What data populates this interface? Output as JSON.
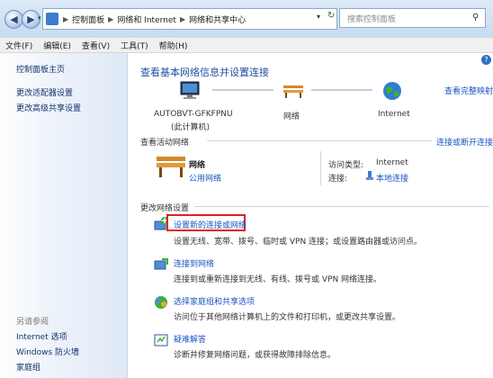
{
  "address": {
    "crumbs": [
      "控制面板",
      "网络和 Internet",
      "网络和共享中心"
    ],
    "search_placeholder": "搜索控制面板"
  },
  "menu": [
    "文件(F)",
    "编辑(E)",
    "查看(V)",
    "工具(T)",
    "帮助(H)"
  ],
  "sidebar": {
    "home": "控制面板主页",
    "links": [
      "更改适配器设置",
      "更改高级共享设置"
    ],
    "see_also": "另请参阅",
    "see_also_links": [
      "Internet 选项",
      "Windows 防火墙",
      "家庭组"
    ]
  },
  "main": {
    "title": "查看基本网络信息并设置连接",
    "view_full_map": "查看完整映射",
    "map": {
      "computer_name": "AUTOBVT-GFKFPNU",
      "computer_sub": "(此计算机)",
      "network": "网络",
      "internet": "Internet"
    },
    "active_label": "查看活动网络",
    "connect_disconnect": "连接或断开连接",
    "active": {
      "name": "网络",
      "type": "公用网络",
      "access_label": "访问类型:",
      "access_value": "Internet",
      "conn_label": "连接:",
      "conn_value": "本地连接"
    },
    "change_label": "更改网络设置",
    "tasks": [
      {
        "title": "设置新的连接或网络",
        "desc": "设置无线、宽带、拨号、临时或 VPN 连接；或设置路由器或访问点。"
      },
      {
        "title": "连接到网络",
        "desc": "连接到或重新连接到无线、有线、拨号或 VPN 网络连接。"
      },
      {
        "title": "选择家庭组和共享选项",
        "desc": "访问位于其他网络计算机上的文件和打印机，或更改共享设置。"
      },
      {
        "title": "疑难解答",
        "desc": "诊断并修复网络问题，或获得故障排除信息。"
      }
    ]
  },
  "colors": {
    "link": "#1a56c2",
    "title": "#1e4fa0",
    "highlight": "#e02020"
  }
}
